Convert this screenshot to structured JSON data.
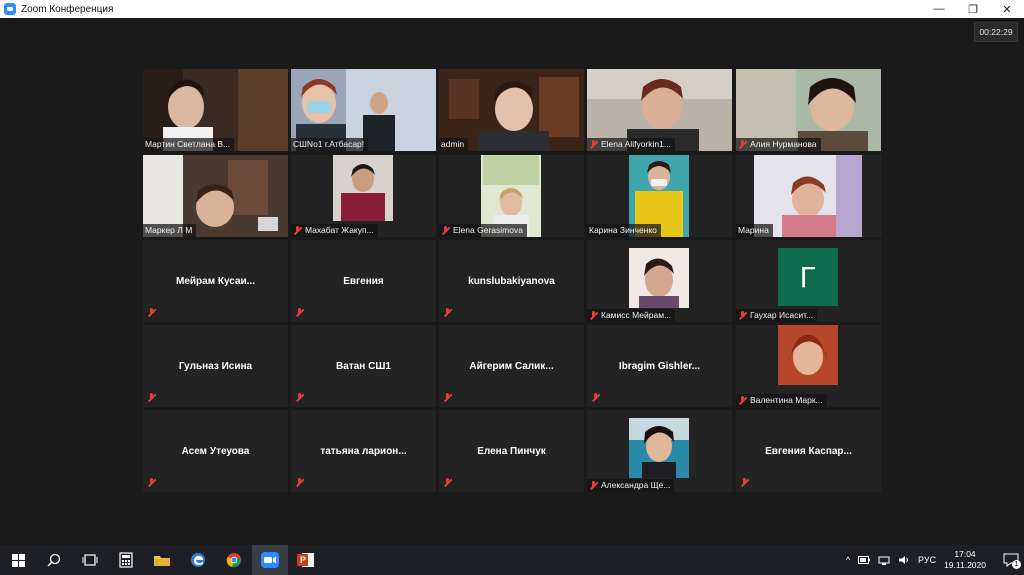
{
  "window": {
    "title": "Zoom Конференция",
    "minimize": "—",
    "restore": "❐",
    "close": "✕"
  },
  "meeting": {
    "timer": "00:22:29"
  },
  "participants": {
    "r1c1": "Мартин Светлана В...",
    "r1c2": "СШNo1 г.Атбасар!",
    "r1c3": "admin",
    "r1c4": "Elena Alifyorkin1...",
    "r1c5": "Алия Нурманова",
    "r2c1": "Маркер Л М",
    "r2c2": "Махабат Жакуп...",
    "r2c3": "Elena Gerasimova",
    "r2c4": "Карина Зинченко",
    "r2c5": "Марина",
    "r3c1": "Мейрам  Кусаи...",
    "r3c2": "Евгения",
    "r3c3": "kunslubakiyanova",
    "r3c4": "Камисс Мейрам...",
    "r3c5": "Гаухар Исасит...",
    "r3c5_avatar": "Г",
    "r4c1": "Гульназ Исина",
    "r4c2": "Ватан СШ1",
    "r4c3": "Айгерим  Салик...",
    "r4c4": "Ibragim  Gishler...",
    "r4c5": "Валентина Марк...",
    "r5c1": "Асем Утеуова",
    "r5c2": "татьяна  ларион...",
    "r5c3": "Елена Пинчук",
    "r5c4": "Александра Ще...",
    "r5c5": "Евгения  Каспар..."
  },
  "taskbar": {
    "lang": "РУС",
    "time": "17:04",
    "date": "19.11.2020",
    "notifications": "1",
    "tray_up": "^"
  },
  "colors": {
    "active_speaker": "#d6e12a",
    "muted": "#e23d3d",
    "zoom_blue": "#2d8cff"
  }
}
